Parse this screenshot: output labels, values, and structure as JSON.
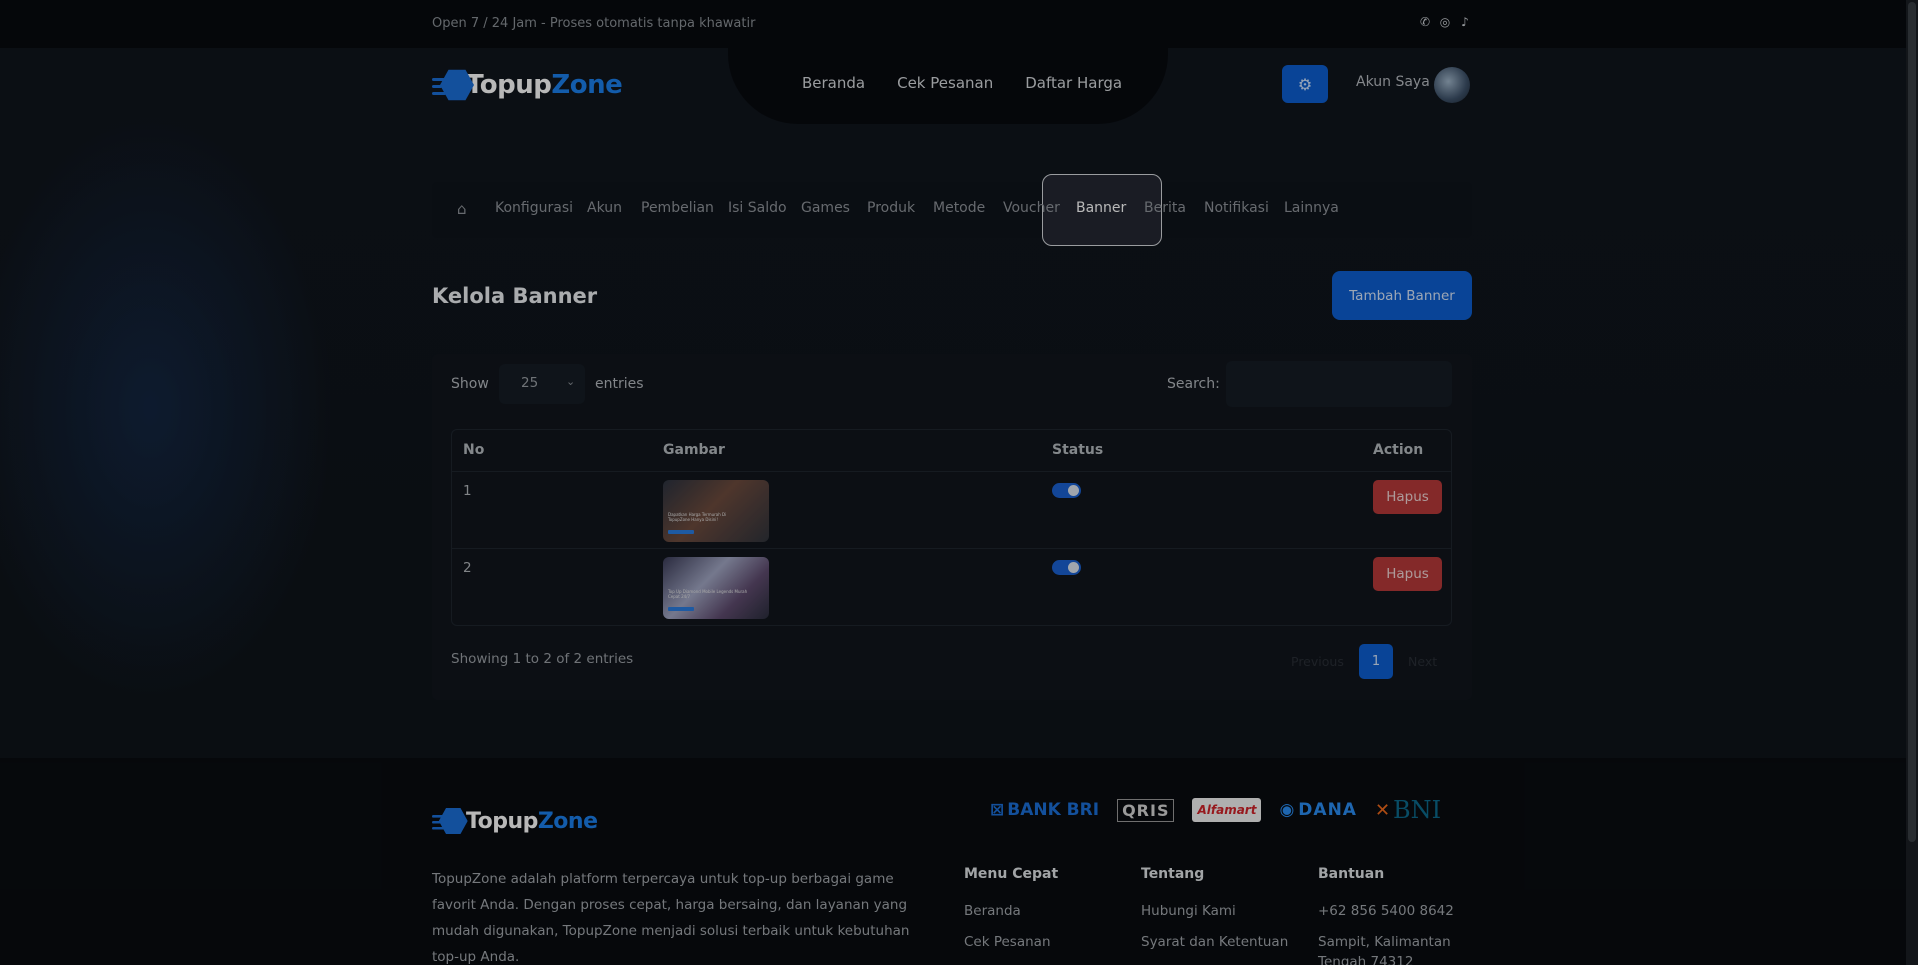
{
  "topbar": {
    "tagline": "Open 7 / 24 Jam - Proses otomatis tanpa khawatir",
    "social_icons": [
      "whatsapp-icon",
      "instagram-icon",
      "tiktok-icon"
    ]
  },
  "brand": {
    "name_part1": "Topup",
    "name_part2": "Zone"
  },
  "nav": {
    "links": [
      "Beranda",
      "Cek Pesanan",
      "Daftar Harga"
    ],
    "account_label": "Akun Saya"
  },
  "admin_tabs": {
    "items": [
      "Konfigurasi",
      "Akun",
      "Pembelian",
      "Isi Saldo",
      "Games",
      "Produk",
      "Metode",
      "Voucher",
      "Banner",
      "Berita",
      "Notifikasi",
      "Lainnya"
    ],
    "active": "Banner"
  },
  "page": {
    "title": "Kelola Banner",
    "add_button": "Tambah Banner"
  },
  "table_controls": {
    "show_label": "Show",
    "entries_value": "25",
    "entries_label": "entries",
    "search_label": "Search:",
    "search_value": ""
  },
  "table": {
    "headers": [
      "No",
      "Gambar",
      "Status",
      "Action"
    ],
    "rows": [
      {
        "no": "1",
        "image_caption": "Dapatkan Harga Termurah Di TopupZone Hanya Disini!",
        "status_on": true,
        "action": "Hapus"
      },
      {
        "no": "2",
        "image_caption": "Top Up Diamond Mobile Legends Murah Cepat 24/7",
        "status_on": true,
        "action": "Hapus"
      }
    ]
  },
  "pagination": {
    "info": "Showing 1 to 2 of 2 entries",
    "previous": "Previous",
    "current": "1",
    "next": "Next"
  },
  "footer": {
    "description": "TopupZone adalah platform terpercaya untuk top-up berbagai game favorit Anda. Dengan proses cepat, harga bersaing, dan layanan yang mudah digunakan, TopupZone menjadi solusi terbaik untuk kebutuhan top-up Anda.",
    "payments": [
      "BANK BRI",
      "QRIS",
      "Alfamart",
      "DANA",
      "BNI"
    ],
    "columns": [
      {
        "title": "Menu Cepat",
        "links": [
          "Beranda",
          "Cek Pesanan"
        ]
      },
      {
        "title": "Tentang",
        "links": [
          "Hubungi Kami",
          "Syarat dan Ketentuan"
        ]
      },
      {
        "title": "Bantuan",
        "links": [
          "+62 856 5400 8642",
          "Sampit, Kalimantan Tengah 74312"
        ]
      }
    ]
  },
  "colors": {
    "accent": "#0d5fd1",
    "danger": "#b83a3a",
    "background": "#0d1117"
  }
}
